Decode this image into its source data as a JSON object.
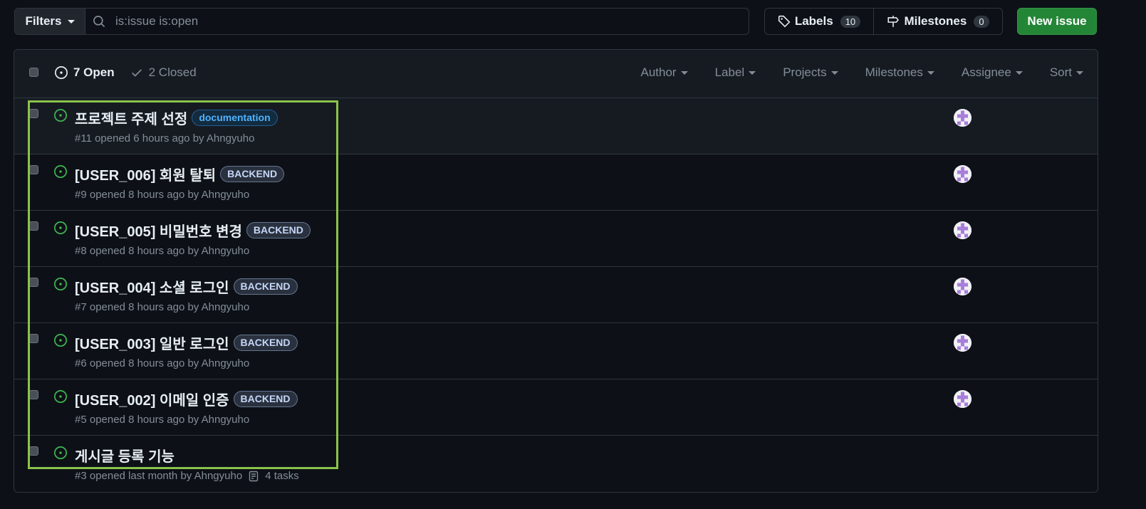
{
  "toolbar": {
    "filters_label": "Filters",
    "search_placeholder": "is:issue is:open",
    "labels_label": "Labels",
    "labels_count": "10",
    "milestones_label": "Milestones",
    "milestones_count": "0",
    "new_issue_label": "New issue"
  },
  "header": {
    "open_label": "7 Open",
    "closed_label": "2 Closed",
    "filters": [
      "Author",
      "Label",
      "Projects",
      "Milestones",
      "Assignee",
      "Sort"
    ]
  },
  "issues": [
    {
      "title": "프로젝트 주제 선정",
      "label": "documentation",
      "meta": "#11 opened 6 hours ago by Ahngyuho"
    },
    {
      "title": "[USER_006] 회원 탈퇴",
      "label": "BACKEND",
      "meta": "#9 opened 8 hours ago by Ahngyuho"
    },
    {
      "title": "[USER_005] 비밀번호 변경",
      "label": "BACKEND",
      "meta": "#8 opened 8 hours ago by Ahngyuho"
    },
    {
      "title": "[USER_004] 소셜 로그인",
      "label": "BACKEND",
      "meta": "#7 opened 8 hours ago by Ahngyuho"
    },
    {
      "title": "[USER_003] 일반 로그인",
      "label": "BACKEND",
      "meta": "#6 opened 8 hours ago by Ahngyuho"
    },
    {
      "title": "[USER_002] 이메일 인증",
      "label": "BACKEND",
      "meta": "#5 opened 8 hours ago by Ahngyuho"
    },
    {
      "title": "게시글 등록 기능",
      "meta": "#3 opened last month by Ahngyuho",
      "tasks": "4 tasks"
    }
  ],
  "icons": {
    "search": "search-icon",
    "tag": "tag-icon",
    "milestone": "milestone-icon",
    "issue_open": "issue-opened-icon",
    "check": "check-icon",
    "checklist": "checklist-icon"
  },
  "colors": {
    "accent_green": "#238636",
    "open_icon": "#3fb950",
    "highlight": "#8bc34a"
  }
}
